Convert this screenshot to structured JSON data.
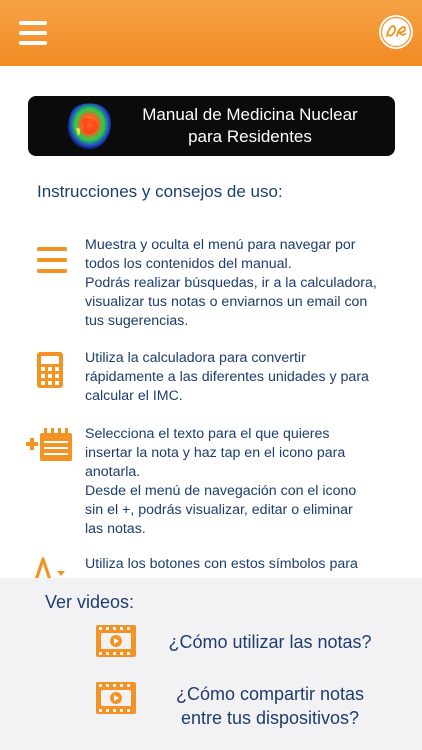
{
  "header": {
    "menu_icon": "hamburger-menu-icon",
    "logo_icon": "ge-logo-icon",
    "colors": {
      "bar_top": "#f6a347",
      "bar_bottom": "#f28a22"
    }
  },
  "banner": {
    "line1": "Manual de Medicina Nuclear",
    "line2": "para Residentes"
  },
  "instructions": {
    "title": "Instrucciones y consejos de uso:",
    "items": [
      {
        "icon": "menu-icon",
        "lines": [
          "Muestra y oculta el menú para navegar por",
          "todos los contenidos del manual.",
          "Podrás realizar búsquedas, ir a la calculadora,",
          "visualizar tus notas o enviarnos un email con",
          "tus sugerencias."
        ]
      },
      {
        "icon": "calculator-icon",
        "lines": [
          "Utiliza la calculadora para convertir",
          "rápidamente a las diferentes unidades y para",
          "calcular el IMC."
        ]
      },
      {
        "icon": "add-note-icon",
        "lines": [
          "Selecciona el texto para el que quieres",
          "insertar la nota y haz tap en el icono para",
          "anotarla.",
          "Desde el menú de navegación con el icono",
          "sin el +, podrás visualizar, editar o eliminar",
          "las notas."
        ]
      },
      {
        "icon": "font-size-icon",
        "lines": [
          "Utiliza los botones con estos símbolos para"
        ]
      }
    ]
  },
  "videos": {
    "title": "Ver videos:",
    "items": [
      {
        "icon": "video-film-icon",
        "lines": [
          "¿Cómo utilizar las notas?"
        ]
      },
      {
        "icon": "video-film-icon",
        "lines": [
          "¿Cómo compartir notas",
          "entre tus dispositivos?"
        ]
      }
    ]
  },
  "accent_color": "#f39323",
  "text_color": "#1d3c6e"
}
